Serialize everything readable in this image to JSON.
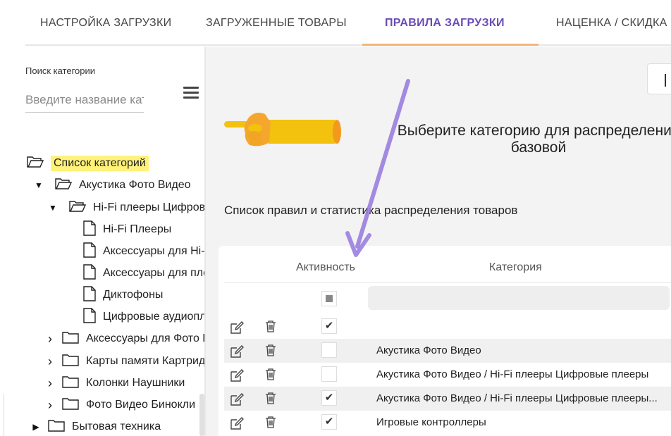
{
  "tabs": [
    {
      "label": "НАСТРОЙКА ЗАГРУЗКИ",
      "active": false
    },
    {
      "label": "ЗАГРУЖЕННЫЕ ТОВАРЫ",
      "active": false
    },
    {
      "label": "ПРАВИЛА ЗАГРУЗКИ",
      "active": true
    },
    {
      "label": "НАЦЕНКА / СКИДКА",
      "active": false
    }
  ],
  "search": {
    "label": "Поиск категории",
    "placeholder": "Введите название категории"
  },
  "tree": {
    "root": "Список категорий",
    "nodes": [
      {
        "label": "Акустика Фото Видео",
        "type": "folder-open",
        "caret": "▼"
      },
      {
        "label": "Hi-Fi плееры Цифровые плееры",
        "type": "folder-open",
        "caret": "▼"
      },
      {
        "label": "Hi-Fi Плееры",
        "type": "file"
      },
      {
        "label": "Аксессуары для Hi-Fi",
        "type": "file"
      },
      {
        "label": "Аксессуары для плееров",
        "type": "file"
      },
      {
        "label": "Диктофоны",
        "type": "file"
      },
      {
        "label": "Цифровые аудиоплееры",
        "type": "file"
      },
      {
        "label": "Аксессуары для Фото Видео",
        "type": "folder",
        "caret": "›"
      },
      {
        "label": "Карты памяти Картридеры",
        "type": "folder",
        "caret": "›"
      },
      {
        "label": "Колонки Наушники",
        "type": "folder",
        "caret": "›"
      },
      {
        "label": "Фото Видео Бинокли",
        "type": "folder",
        "caret": "›"
      },
      {
        "label": "Бытовая техника",
        "type": "folder",
        "caret": "▶"
      }
    ]
  },
  "main": {
    "hint_line1": "Выберите категорию для распределения",
    "hint_line2": "базовой",
    "rules_title": "Список правил и статистика распределения товаров",
    "columns": {
      "active": "Активность",
      "category": "Категория"
    },
    "rows": [
      {
        "checked": true,
        "category": ""
      },
      {
        "checked": false,
        "category": "Акустика Фото Видео"
      },
      {
        "checked": false,
        "category": "Акустика Фото Видео / Hi-Fi плееры Цифровые плееры"
      },
      {
        "checked": true,
        "category": "Акустика Фото Видео / Hi-Fi плееры Цифровые плееры..."
      },
      {
        "checked": true,
        "category": "Игровые контроллеры"
      }
    ],
    "check_glyph": "✔"
  },
  "colors": {
    "accent": "#6a4bb5",
    "tab_underline": "#f2b57a",
    "highlight": "#fff27a",
    "annotation_arrow": "#9b7fe0"
  }
}
